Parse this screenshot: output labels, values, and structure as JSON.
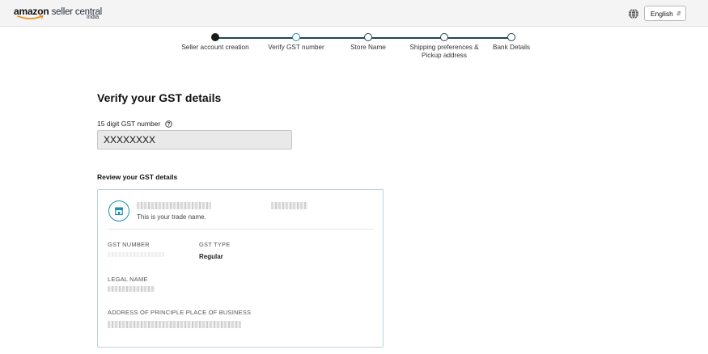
{
  "header": {
    "brand": "amazon",
    "product": "seller central",
    "region": "India",
    "language_selected": "English"
  },
  "stepper": {
    "steps": [
      {
        "label": "Seller account creation",
        "state": "done"
      },
      {
        "label": "Verify GST number",
        "state": "current"
      },
      {
        "label": "Store Name",
        "state": "todo"
      },
      {
        "label": "Shipping preferences & Pickup address",
        "state": "todo"
      },
      {
        "label": "Bank Details",
        "state": "todo"
      }
    ]
  },
  "form": {
    "title": "Verify your GST details",
    "gst_label": "15 digit GST number",
    "gst_value": "XXXXXXXX"
  },
  "review": {
    "title": "Review your GST details",
    "trade_name_hint": "This is your trade name.",
    "gst_number_label": "GST NUMBER",
    "gst_type_label": "GST TYPE",
    "gst_type_value": "Regular",
    "legal_name_label": "LEGAL NAME",
    "address_label": "ADDRESS OF PRINCIPLE PLACE OF BUSINESS"
  },
  "icons": {
    "globe": "globe-icon",
    "help": "help-circle-icon",
    "store": "store-icon",
    "caret": "up-down-caret-icon"
  },
  "colors": {
    "accent": "#1f8fae",
    "stepper_line": "#20464e",
    "card_border": "#bcd6dc",
    "input_bg": "#e9e9e9"
  }
}
